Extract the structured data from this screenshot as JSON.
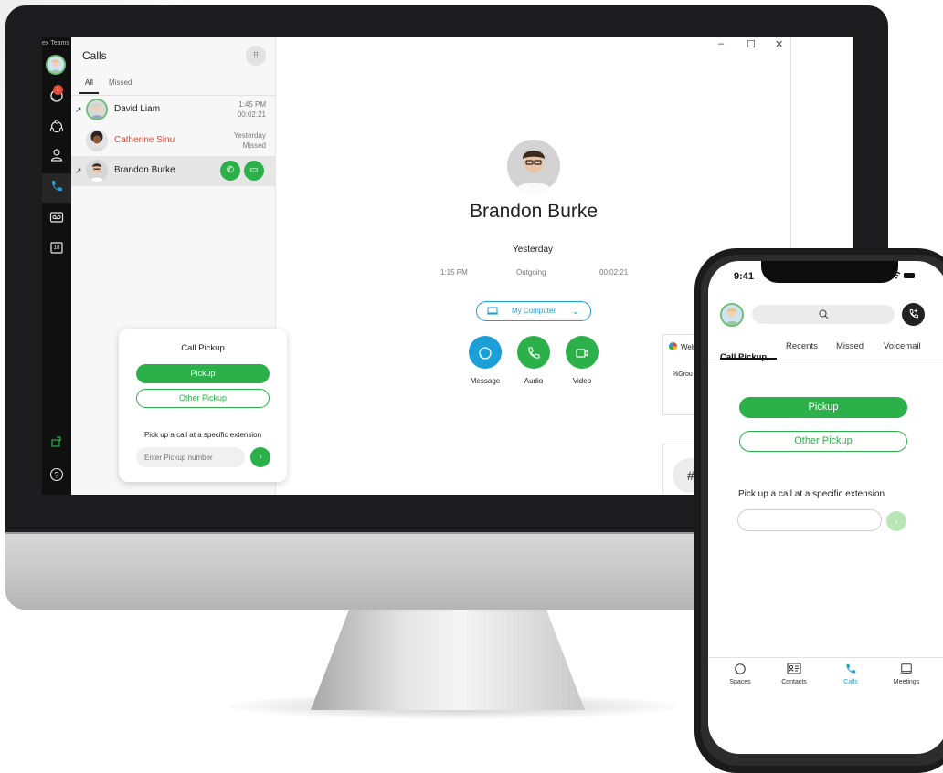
{
  "desktop": {
    "app_title": "ex Teams",
    "rail": {
      "messaging_badge": "1",
      "calendar_day": "18"
    },
    "calls": {
      "title": "Calls",
      "tabs": [
        "All",
        "Missed"
      ],
      "entries": [
        {
          "name": "David Liam",
          "time": "1:45 PM",
          "detail": "00:02:21",
          "direction": "↗"
        },
        {
          "name": "Catherine Sinu",
          "time": "Yesterday",
          "detail": "Missed",
          "direction": ""
        },
        {
          "name": "Brandon Burke",
          "time": "",
          "detail": "",
          "direction": "↗"
        }
      ]
    },
    "pickup": {
      "title": "Call Pickup",
      "pickup_label": "Pickup",
      "other_label": "Other Pickup",
      "subtitle": "Pick up a call at a specific extension",
      "placeholder": "Enter Pickup number"
    },
    "detail": {
      "name": "Brandon Burke",
      "when": "Yesterday",
      "start": "1:15 PM",
      "direction": "Outgoing",
      "duration": "00:02:21",
      "device": "My Computer",
      "actions": [
        "Message",
        "Audio",
        "Video"
      ]
    },
    "side": {
      "web_label": "Web",
      "group_label": "%Grou",
      "hash": "#"
    },
    "colors": {
      "green": "#2bb04a",
      "blue": "#1a9fd6",
      "missed": "#e04b37"
    }
  },
  "phone": {
    "time": "9:41",
    "tabs": [
      "Call Pickup",
      "Recents",
      "Missed",
      "Voicemail"
    ],
    "pickup_label": "Pickup",
    "other_label": "Other Pickup",
    "subtitle": "Pick up a call at a specific extension",
    "nav": [
      "Spaces",
      "Contacts",
      "Calls",
      "Meetings"
    ]
  }
}
